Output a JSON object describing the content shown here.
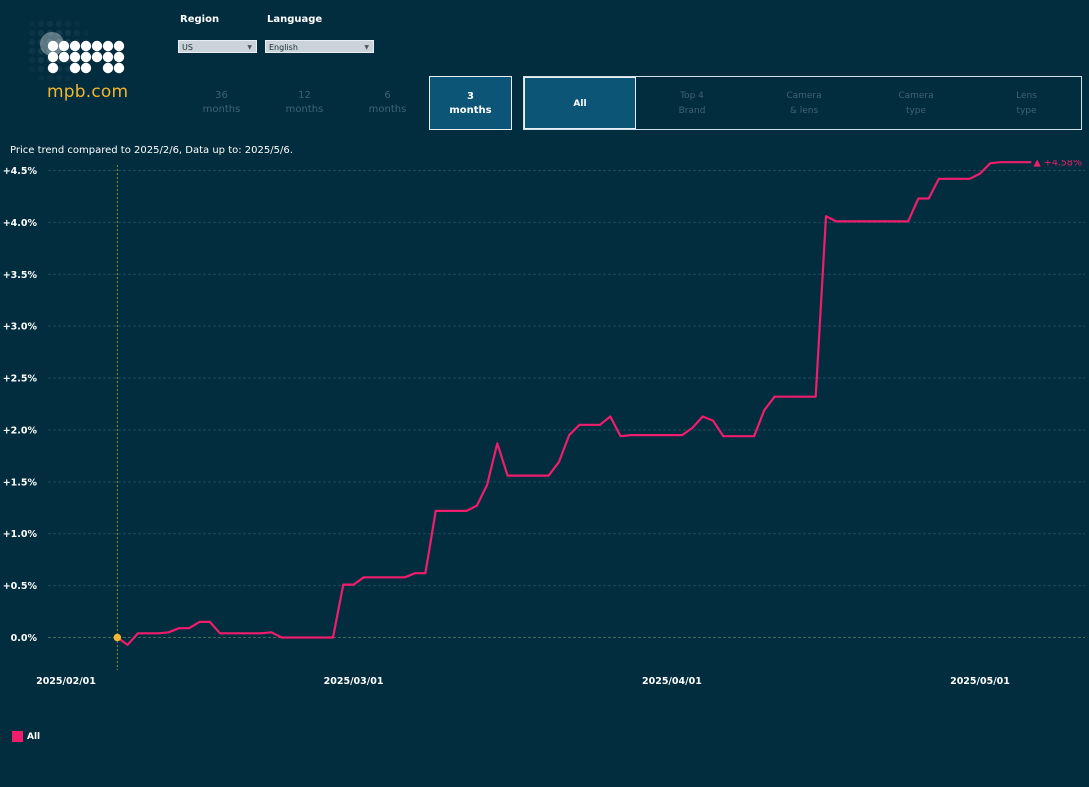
{
  "brand": {
    "logo_text": "mpb.com",
    "logo_color": "#f5b731"
  },
  "controls": {
    "region_label": "Region",
    "region_value": "US",
    "language_label": "Language",
    "language_value": "English"
  },
  "time_tabs": [
    {
      "line1": "36",
      "line2": "months",
      "active": false
    },
    {
      "line1": "12",
      "line2": "months",
      "active": false
    },
    {
      "line1": "6",
      "line2": "months",
      "active": false
    },
    {
      "line1": "3",
      "line2": "months",
      "active": true
    }
  ],
  "category_tabs": [
    {
      "line1": "All",
      "line2": "",
      "active": true
    },
    {
      "line1": "Top 4",
      "line2": "Brand",
      "active": false
    },
    {
      "line1": "Camera",
      "line2": "& lens",
      "active": false
    },
    {
      "line1": "Camera",
      "line2": "type",
      "active": false
    },
    {
      "line1": "Lens",
      "line2": "type",
      "active": false
    }
  ],
  "subtitle": "Price trend compared to 2025/2/6, Data up to: 2025/5/6.",
  "legend": {
    "label": "All"
  },
  "colors": {
    "background": "#022d3f",
    "series": "#f01d6c",
    "baseline_marker": "#f5b731",
    "active_tab": "#0c5577"
  },
  "chart_data": {
    "type": "line",
    "title": "",
    "xlabel": "",
    "ylabel": "",
    "ylim": [
      -0.3,
      4.8
    ],
    "y_ticks": [
      0.0,
      0.5,
      1.0,
      1.5,
      2.0,
      2.5,
      3.0,
      3.5,
      4.0,
      4.5
    ],
    "y_tick_labels": [
      "0.0%",
      "+0.5%",
      "+1.0%",
      "+1.5%",
      "+2.0%",
      "+2.5%",
      "+3.0%",
      "+3.5%",
      "+4.0%",
      "+4.5%"
    ],
    "x_ticks": [
      "2025/02/01",
      "2025/03/01",
      "2025/04/01",
      "2025/05/01"
    ],
    "grid": true,
    "legend_position": "bottom-left",
    "end_label": "▲ +4.58%",
    "series": [
      {
        "name": "All",
        "points": [
          [
            "2025/02/06",
            0.0
          ],
          [
            "2025/02/07",
            -0.07
          ],
          [
            "2025/02/08",
            0.04
          ],
          [
            "2025/02/09",
            0.04
          ],
          [
            "2025/02/10",
            0.04
          ],
          [
            "2025/02/11",
            0.05
          ],
          [
            "2025/02/12",
            0.09
          ],
          [
            "2025/02/13",
            0.09
          ],
          [
            "2025/02/14",
            0.15
          ],
          [
            "2025/02/15",
            0.15
          ],
          [
            "2025/02/16",
            0.04
          ],
          [
            "2025/02/17",
            0.04
          ],
          [
            "2025/02/20",
            0.04
          ],
          [
            "2025/02/21",
            0.05
          ],
          [
            "2025/02/22",
            0.0
          ],
          [
            "2025/02/27",
            0.0
          ],
          [
            "2025/02/28",
            0.51
          ],
          [
            "2025/03/01",
            0.51
          ],
          [
            "2025/03/02",
            0.58
          ],
          [
            "2025/03/06",
            0.58
          ],
          [
            "2025/03/07",
            0.62
          ],
          [
            "2025/03/08",
            0.62
          ],
          [
            "2025/03/09",
            1.22
          ],
          [
            "2025/03/12",
            1.22
          ],
          [
            "2025/03/13",
            1.27
          ],
          [
            "2025/03/14",
            1.47
          ],
          [
            "2025/03/15",
            1.87
          ],
          [
            "2025/03/16",
            1.56
          ],
          [
            "2025/03/20",
            1.56
          ],
          [
            "2025/03/21",
            1.69
          ],
          [
            "2025/03/22",
            1.95
          ],
          [
            "2025/03/23",
            2.05
          ],
          [
            "2025/03/25",
            2.05
          ],
          [
            "2025/03/26",
            2.13
          ],
          [
            "2025/03/27",
            1.94
          ],
          [
            "2025/03/28",
            1.95
          ],
          [
            "2025/04/02",
            1.95
          ],
          [
            "2025/04/03",
            2.02
          ],
          [
            "2025/04/04",
            2.13
          ],
          [
            "2025/04/05",
            2.09
          ],
          [
            "2025/04/06",
            1.94
          ],
          [
            "2025/04/09",
            1.94
          ],
          [
            "2025/04/10",
            2.19
          ],
          [
            "2025/04/11",
            2.32
          ],
          [
            "2025/04/15",
            2.32
          ],
          [
            "2025/04/16",
            4.06
          ],
          [
            "2025/04/17",
            4.01
          ],
          [
            "2025/04/24",
            4.01
          ],
          [
            "2025/04/25",
            4.23
          ],
          [
            "2025/04/26",
            4.23
          ],
          [
            "2025/04/27",
            4.42
          ],
          [
            "2025/04/30",
            4.42
          ],
          [
            "2025/05/01",
            4.47
          ],
          [
            "2025/05/02",
            4.57
          ],
          [
            "2025/05/03",
            4.58
          ],
          [
            "2025/05/06",
            4.58
          ]
        ]
      }
    ]
  }
}
